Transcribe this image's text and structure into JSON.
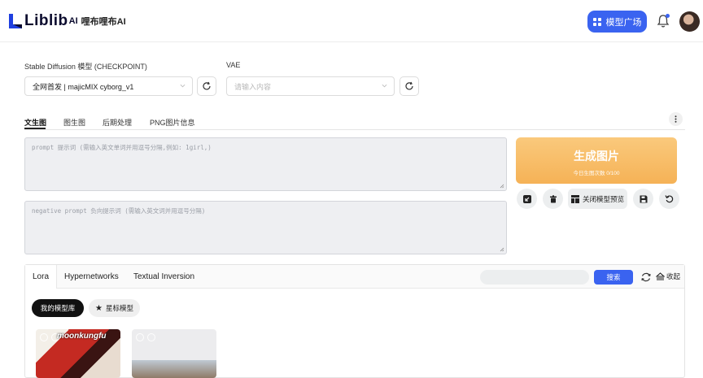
{
  "header": {
    "logo_text": "Liblib",
    "logo_ai": "AI",
    "logo_cn": "哩布哩布AI",
    "market_button": "模型广场"
  },
  "checkpoint": {
    "label": "Stable Diffusion 模型 (CHECKPOINT)",
    "value": "全网首发 | majicMIX cyborg_v1"
  },
  "vae": {
    "label": "VAE",
    "placeholder": "请输入内容"
  },
  "tabs": [
    {
      "label": "文生图",
      "active": true
    },
    {
      "label": "图生图"
    },
    {
      "label": "后期处理"
    },
    {
      "label": "PNG图片信息"
    }
  ],
  "prompt": {
    "placeholder": "prompt 提示词 (需输入英文单词并用逗号分隔,例如: 1girl,)",
    "negative_placeholder": "negative prompt 负向提示词 (需输入英文词并用逗号分隔)"
  },
  "generate": {
    "title": "生成图片",
    "subtitle": "今日生图次数 0/100",
    "preview_button": "关闭模型预览"
  },
  "lora_panel": {
    "tabs": [
      "Lora",
      "Hypernetworks",
      "Textual Inversion"
    ],
    "search_button": "搜索",
    "collapse_label": "收起",
    "my_models": "我的模型库",
    "starred": "星标模型",
    "card1_text": "moonkungfu"
  },
  "colors": {
    "accent": "#3a63f0",
    "generate": "#f7bc66"
  }
}
